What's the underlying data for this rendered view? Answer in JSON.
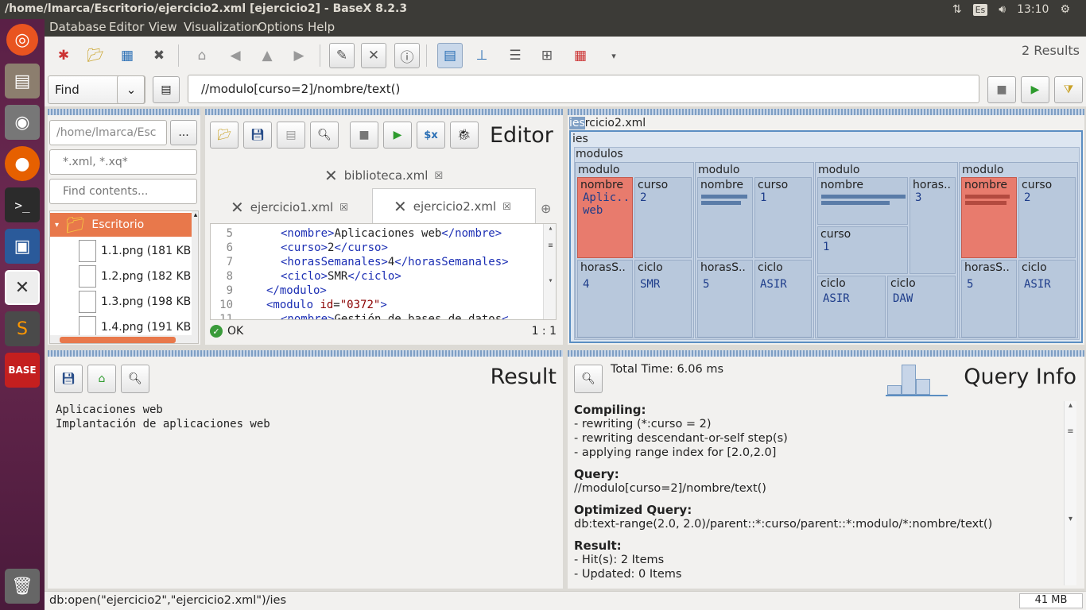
{
  "window": {
    "title": "/home/lmarca/Escritorio/ejercicio2.xml [ejercicio2] - BaseX 8.2.3",
    "time": "13:10",
    "keyboard": "Es"
  },
  "menu": [
    "Database",
    "Editor",
    "View",
    "Visualization",
    "Options",
    "Help"
  ],
  "toolbar": {
    "results": "2 Results"
  },
  "find": {
    "mode": "Find",
    "query": "//modulo[curso=2]/nombre/text()"
  },
  "project": {
    "path": "/home/lmarca/Esc",
    "browse": "...",
    "filter_placeholder": "*.xml, *.xq*",
    "contents_placeholder": "Find contents...",
    "folder": "Escritorio",
    "files": [
      "1.1.png (181 KB)",
      "1.2.png (182 KB)",
      "1.3.png (198 KB)",
      "1.4.png (191 KB)"
    ]
  },
  "editor": {
    "title": "Editor",
    "tab_top": "biblioteca.xml",
    "tabs": [
      "ejercicio1.xml",
      "ejercicio2.xml"
    ],
    "status": "OK",
    "cursor": "1 : 1",
    "line_numbers": [
      "5",
      "6",
      "7",
      "8",
      "9",
      "10",
      "11"
    ]
  },
  "map": {
    "path_hl": "ies",
    "path_rest": "rcicio2.xml",
    "root": "ies",
    "modulos": "modulos",
    "modulo": "modulo",
    "nombre": "nombre",
    "curso": "curso",
    "horasS": "horasS..",
    "horas_full": "horas..",
    "ciclo": "ciclo",
    "m1": {
      "nombre": "Aplic.. web",
      "curso": "2",
      "horas": "4",
      "ciclo": "SMR"
    },
    "m2": {
      "curso": "1",
      "horas": "5",
      "ciclo": "ASIR"
    },
    "m3": {
      "horas": "3",
      "curso": "1",
      "ciclo1": "ASIR",
      "ciclo2": "DAW"
    },
    "m4": {
      "curso": "2",
      "horas": "5",
      "ciclo": "ASIR"
    }
  },
  "result": {
    "title": "Result",
    "lines": [
      "Aplicaciones web",
      "Implantación de aplicaciones web"
    ]
  },
  "queryinfo": {
    "title": "Query Info",
    "total": "Total Time: 6.06 ms",
    "compiling_h": "Compiling:",
    "compiling": [
      "- rewriting (*:curso = 2)",
      "- rewriting descendant-or-self step(s)",
      "- applying range index for [2.0,2.0]"
    ],
    "query_h": "Query:",
    "query": "//modulo[curso=2]/nombre/text()",
    "opt_h": "Optimized Query:",
    "opt": "db:text-range(2.0, 2.0)/parent::*:curso/parent::*:modulo/*:nombre/text()",
    "result_h": "Result:",
    "result": [
      "- Hit(s): 2 Items",
      "- Updated: 0 Items"
    ]
  },
  "status": {
    "left": "db:open(\"ejercicio2\",\"ejercicio2.xml\")/ies",
    "mem": "41 MB"
  }
}
